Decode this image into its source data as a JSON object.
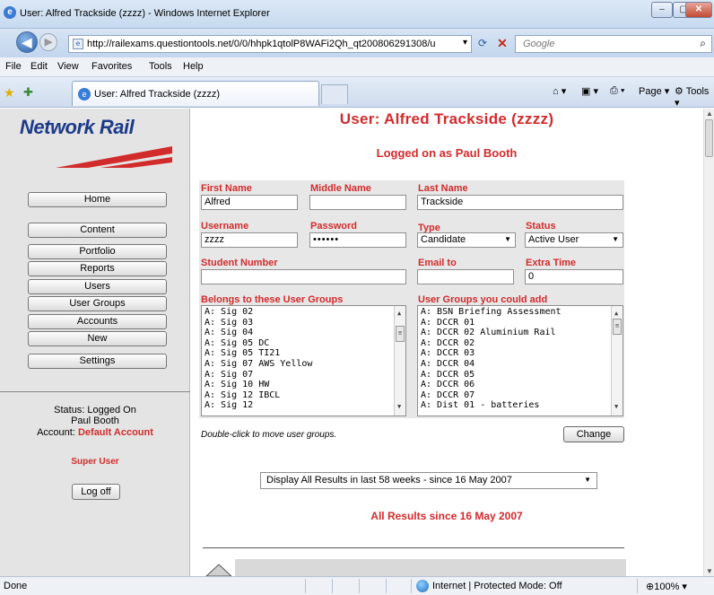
{
  "window": {
    "title": "User: Alfred Trackside (zzzz) - Windows Internet Explorer"
  },
  "address": {
    "url": "http://railexams.questiontools.net/0/0/hhpk1qtolP8WAFi2Qh_qt200806291308/u",
    "search_placeholder": "Google"
  },
  "menu": [
    "File",
    "Edit",
    "View",
    "Favorites",
    "Tools",
    "Help"
  ],
  "tab": {
    "title": "User: Alfred Trackside (zzzz)"
  },
  "commandbar": {
    "page": "Page",
    "tools": "Tools"
  },
  "sidebar": {
    "logo": "Network Rail",
    "buttons": [
      "Home",
      "Content",
      "Portfolio",
      "Reports",
      "Users",
      "User Groups",
      "Accounts",
      "New",
      "Settings"
    ],
    "status_line": "Status: Logged On",
    "user_name": "Paul Booth",
    "account_label": "Account:",
    "account_value": "Default Account",
    "role": "Super User",
    "logoff": "Log off"
  },
  "page": {
    "title": "User: Alfred Trackside (zzzz)",
    "logged_on": "Logged on as Paul Booth"
  },
  "form": {
    "first_name": {
      "label": "First Name",
      "value": "Alfred"
    },
    "middle_name": {
      "label": "Middle Name",
      "value": ""
    },
    "last_name": {
      "label": "Last Name",
      "value": "Trackside"
    },
    "username": {
      "label": "Username",
      "value": "zzzz"
    },
    "password": {
      "label": "Password",
      "value": "••••••"
    },
    "type": {
      "label": "Type",
      "value": "Candidate"
    },
    "status": {
      "label": "Status",
      "value": "Active User"
    },
    "student_number": {
      "label": "Student Number",
      "value": ""
    },
    "email_to": {
      "label": "Email to",
      "value": ""
    },
    "extra_time": {
      "label": "Extra Time",
      "value": "0"
    },
    "belongs_label": "Belongs to these User Groups",
    "belongs": [
      "A: Sig 02",
      "A: Sig 03",
      "A: Sig 04",
      "A: Sig 05 DC",
      "A: Sig 05 TI21",
      "A: Sig 07 AWS Yellow",
      "A: Sig 07",
      "A: Sig 10 HW",
      "A: Sig 12 IBCL",
      "A: Sig 12"
    ],
    "could_add_label": "User Groups you could add",
    "could_add": [
      "A: BSN Briefing Assessment",
      "A: DCCR 01",
      "A: DCCR 02 Aluminium Rail",
      "A: DCCR 02",
      "A: DCCR 03",
      "A: DCCR 04",
      "A: DCCR 05",
      "A: DCCR 06",
      "A: DCCR 07",
      "A: Dist 01 - batteries"
    ],
    "hint": "Double-click to move user groups.",
    "change_button": "Change"
  },
  "results": {
    "select": "Display All Results in last 58 weeks - since 16 May 2007",
    "heading": "All Results since 16 May 2007"
  },
  "statusbar": {
    "text": "Done",
    "zone": "Internet | Protected Mode: Off",
    "zoom": "100%"
  }
}
